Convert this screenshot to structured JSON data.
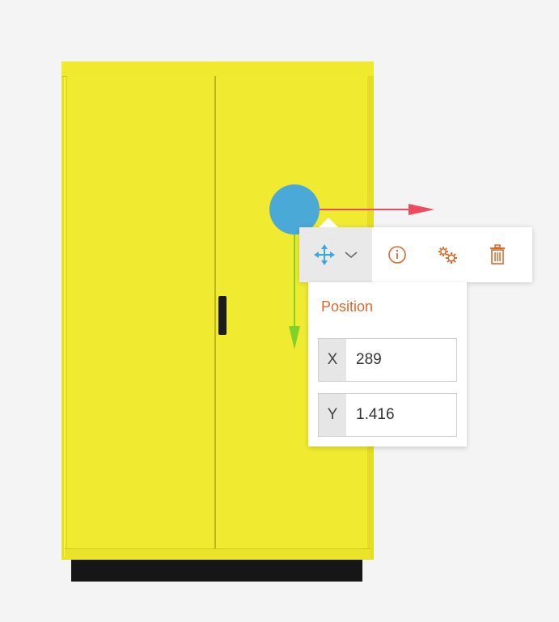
{
  "toolbar": {
    "move_icon": "move-arrows-icon",
    "dropdown_icon": "chevron-down-icon",
    "info_icon": "info-icon",
    "settings_icon": "gears-icon",
    "delete_icon": "trash-icon",
    "accent_color": "#d96a2c",
    "move_color": "#3aa7df"
  },
  "position_panel": {
    "title": "Position",
    "x_label": "X",
    "x_value": "289",
    "y_label": "Y",
    "y_value": "1.416"
  },
  "gizmo": {
    "x_axis_color": "#ee4c5e",
    "y_axis_color": "#7fd12c",
    "handle_color": "#4ba9d8"
  },
  "object": {
    "body_color": "#efea2d",
    "handle_color": "#1b1b1b",
    "base_color": "#161616"
  }
}
